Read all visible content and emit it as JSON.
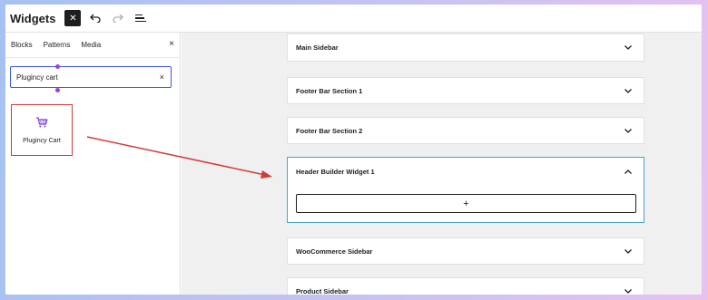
{
  "header": {
    "title": "Widgets",
    "close_icon": "close-icon",
    "undo_icon": "undo-icon",
    "redo_icon": "redo-icon",
    "menu_icon": "list-view-icon"
  },
  "sidebar": {
    "tabs": [
      {
        "label": "Blocks"
      },
      {
        "label": "Patterns"
      },
      {
        "label": "Media"
      }
    ],
    "close": "×",
    "search": {
      "value": "Plugincy cart",
      "clear": "×"
    },
    "result": {
      "label": "Plugincy Cart",
      "icon": "cart-icon"
    }
  },
  "canvas": {
    "areas": [
      {
        "title": "Main Sidebar",
        "state": "collapsed"
      },
      {
        "title": "Footer Bar Section 1",
        "state": "collapsed"
      },
      {
        "title": "Footer Bar Section 2",
        "state": "collapsed"
      },
      {
        "title": "Header Builder Widget 1",
        "state": "expanded",
        "add_label": "+"
      },
      {
        "title": "WooCommerce Sidebar",
        "state": "collapsed"
      },
      {
        "title": "Product Sidebar",
        "state": "collapsed"
      }
    ]
  },
  "colors": {
    "accent": "#3858e9",
    "highlight_box": "#d33a3a",
    "expanded_border": "#4aa3c9",
    "cart_icon": "#7b3fe4"
  }
}
